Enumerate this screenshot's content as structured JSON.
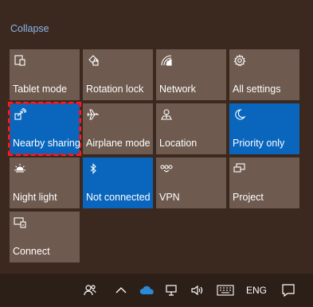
{
  "header": {
    "collapse_label": "Collapse"
  },
  "tiles": [
    {
      "label": "Tablet mode",
      "icon": "tablet-mode-icon",
      "active": false
    },
    {
      "label": "Rotation lock",
      "icon": "rotation-lock-icon",
      "active": false
    },
    {
      "label": "Network",
      "icon": "network-icon",
      "active": false
    },
    {
      "label": "All settings",
      "icon": "gear-icon",
      "active": false
    },
    {
      "label": "Nearby sharing",
      "icon": "nearby-sharing-icon",
      "active": true
    },
    {
      "label": "Airplane mode",
      "icon": "airplane-icon",
      "active": false
    },
    {
      "label": "Location",
      "icon": "location-icon",
      "active": false
    },
    {
      "label": "Priority only",
      "icon": "moon-icon",
      "active": true
    },
    {
      "label": "Night light",
      "icon": "sun-icon",
      "active": false
    },
    {
      "label": "Not connected",
      "icon": "bluetooth-icon",
      "active": true
    },
    {
      "label": "VPN",
      "icon": "vpn-icon",
      "active": false
    },
    {
      "label": "Project",
      "icon": "project-icon",
      "active": false
    },
    {
      "label": "Connect",
      "icon": "connect-icon",
      "active": false
    }
  ],
  "taskbar": {
    "language": "ENG",
    "icons": [
      "people-icon",
      "chevron-up-icon",
      "onedrive-icon",
      "network-wired-icon",
      "volume-icon",
      "keyboard-icon",
      "notification-icon"
    ]
  },
  "colors": {
    "tile": "#6e5a4f",
    "tile_active": "#0a66bd",
    "link": "#8ab4e8",
    "focus": "#e0141c"
  }
}
